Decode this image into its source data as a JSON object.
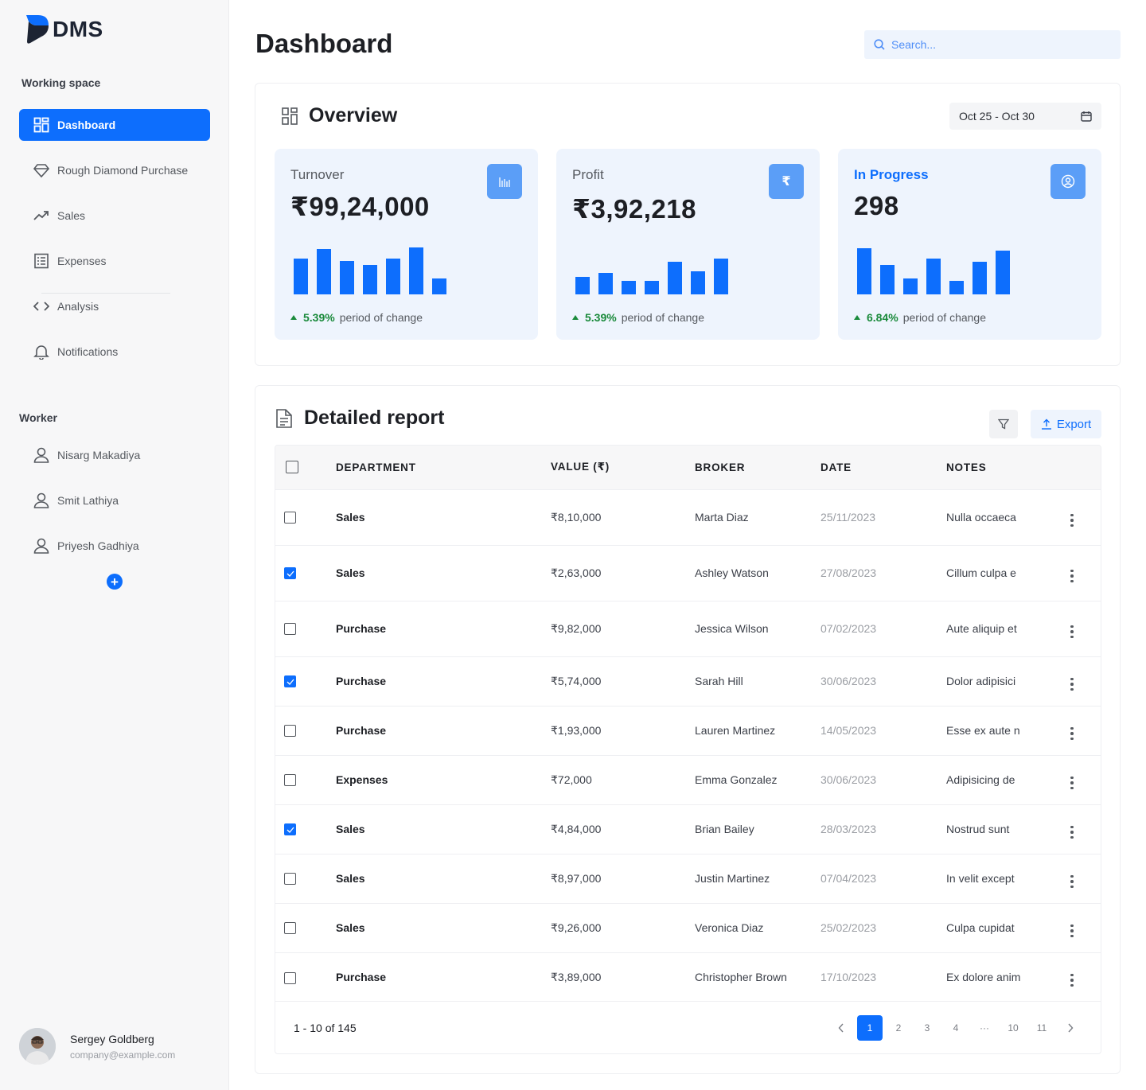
{
  "app": {
    "logo_text": "DMS"
  },
  "sidebar": {
    "working_space_label": "Working space",
    "items": [
      {
        "label": "Dashboard",
        "icon": "dashboard-icon",
        "active": true
      },
      {
        "label": "Rough Diamond Purchase",
        "icon": "diamond-icon"
      },
      {
        "label": "Sales",
        "icon": "trending-up-icon"
      },
      {
        "label": "Expenses",
        "icon": "receipt-icon"
      },
      {
        "label": "Analysis",
        "icon": "code-icon"
      },
      {
        "label": "Notifications",
        "icon": "bell-icon"
      }
    ],
    "worker_label": "Worker",
    "workers": [
      {
        "name": "Nisarg Makadiya",
        "icon": "user-icon"
      },
      {
        "name": "Smit Lathiya",
        "icon": "user-icon"
      },
      {
        "name": "Priyesh Gadhiya",
        "icon": "user-icon"
      }
    ],
    "add_worker_symbol": "+",
    "user": {
      "name": "Sergey Goldberg",
      "email": "company@example.com"
    }
  },
  "header": {
    "title": "Dashboard",
    "search_placeholder": "Search..."
  },
  "overview": {
    "title": "Overview",
    "date_range": "Oct 25 - Oct 30",
    "cards": [
      {
        "label": "Turnover",
        "value": "₹99,24,000",
        "icon": "bar-chart-icon",
        "icon_text": "",
        "change": "5.39%",
        "change_text": "period of change",
        "bars": [
          0.72,
          0.92,
          0.67,
          0.59,
          0.72,
          0.95,
          0.33
        ]
      },
      {
        "label": "Profit",
        "value": "₹3,92,218",
        "icon": "rupee-icon",
        "icon_text": "₹",
        "change": "5.39%",
        "change_text": "period of change",
        "bars": [
          0.36,
          0.44,
          0.28,
          0.28,
          0.66,
          0.47,
          0.72
        ]
      },
      {
        "label": "In Progress",
        "value": "298",
        "icon": "progress-user-icon",
        "icon_text": "",
        "change": "6.84%",
        "change_text": "period of change",
        "bars": [
          0.94,
          0.59,
          0.33,
          0.72,
          0.28,
          0.66,
          0.89
        ]
      }
    ],
    "colors": {
      "accent": "#0d6efd",
      "card_bg": "#eef4fd",
      "positive": "#1a8a3b"
    }
  },
  "report": {
    "title": "Detailed report",
    "export_label": "Export",
    "columns": [
      "DEPARTMENT",
      "VALUE (₹)",
      "BROKER",
      "DATE",
      "NOTES"
    ],
    "rows": [
      {
        "checked": false,
        "department": "Sales",
        "value": "₹8,10,000",
        "broker": "Marta Diaz",
        "date": "25/11/2023",
        "notes": "Nulla occaeca"
      },
      {
        "checked": true,
        "department": "Sales",
        "value": "₹2,63,000",
        "broker": "Ashley Watson",
        "date": "27/08/2023",
        "notes": "Cillum culpa e"
      },
      {
        "checked": false,
        "department": "Purchase",
        "value": "₹9,82,000",
        "broker": "Jessica Wilson",
        "date": "07/02/2023",
        "notes": "Aute aliquip et"
      },
      {
        "checked": true,
        "department": "Purchase",
        "value": "₹5,74,000",
        "broker": "Sarah Hill",
        "date": "30/06/2023",
        "notes": "Dolor adipisici"
      },
      {
        "checked": false,
        "department": "Purchase",
        "value": "₹1,93,000",
        "broker": "Lauren Martinez",
        "date": "14/05/2023",
        "notes": "Esse ex aute n"
      },
      {
        "checked": false,
        "department": "Expenses",
        "value": "₹72,000",
        "broker": "Emma Gonzalez",
        "date": "30/06/2023",
        "notes": "Adipisicing de"
      },
      {
        "checked": true,
        "department": "Sales",
        "value": "₹4,84,000",
        "broker": "Brian Bailey",
        "date": "28/03/2023",
        "notes": "Nostrud sunt"
      },
      {
        "checked": false,
        "department": "Sales",
        "value": "₹8,97,000",
        "broker": "Justin Martinez",
        "date": "07/04/2023",
        "notes": "In velit except"
      },
      {
        "checked": false,
        "department": "Sales",
        "value": "₹9,26,000",
        "broker": "Veronica Diaz",
        "date": "25/02/2023",
        "notes": "Culpa cupidat"
      },
      {
        "checked": false,
        "department": "Purchase",
        "value": "₹3,89,000",
        "broker": "Christopher Brown",
        "date": "17/10/2023",
        "notes": "Ex dolore anim"
      }
    ],
    "pagination": {
      "range_text": "1 - 10 of 145",
      "pages": [
        "1",
        "2",
        "3",
        "4",
        "···",
        "10",
        "11"
      ],
      "current": "1"
    }
  }
}
